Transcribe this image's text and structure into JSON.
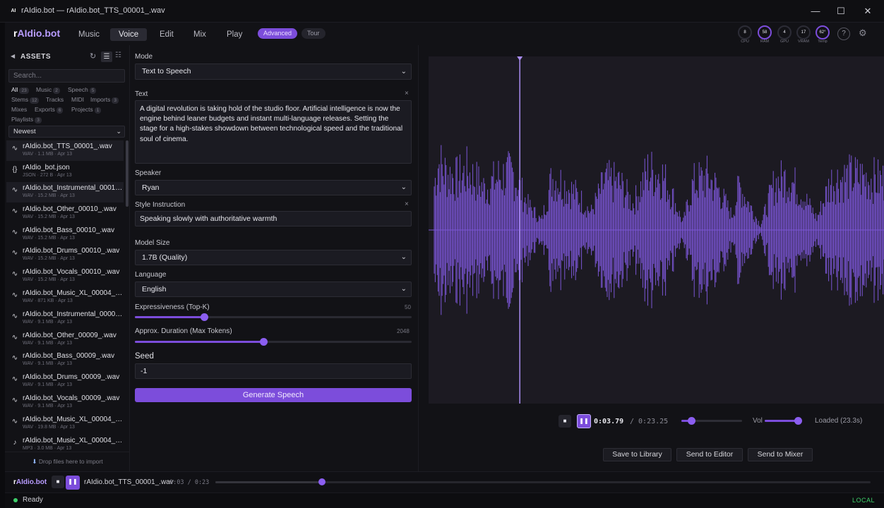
{
  "window": {
    "title": "rAIdio.bot — rAIdio.bot_TTS_00001_.wav",
    "icon_text": "AI",
    "controls": [
      "—",
      "☐",
      "✕"
    ]
  },
  "header": {
    "brand_prefix": "r",
    "brand_rest": "AIdio.bot",
    "tabs": [
      "Music",
      "Voice",
      "Edit",
      "Mix",
      "Play"
    ],
    "active_tab": "Voice",
    "advanced_label": "Advanced",
    "tour_label": "Tour",
    "gauges": [
      {
        "value": "8",
        "label": "CPU"
      },
      {
        "value": "58",
        "label": "RAM"
      },
      {
        "value": "4",
        "label": "GPU"
      },
      {
        "value": "17",
        "label": "VRAM"
      },
      {
        "value": "62°",
        "label": "Temp"
      }
    ],
    "help_glyph": "?",
    "settings_glyph": "⚙"
  },
  "sidebar": {
    "title": "ASSETS",
    "search_placeholder": "Search...",
    "filters": [
      {
        "label": "All",
        "count": "23",
        "active": true
      },
      {
        "label": "Music",
        "count": "2"
      },
      {
        "label": "Speech",
        "count": "5"
      },
      {
        "label": "Stems",
        "count": "12"
      },
      {
        "label": "Tracks",
        "count": ""
      },
      {
        "label": "MIDI",
        "count": ""
      },
      {
        "label": "Imports",
        "count": "3"
      },
      {
        "label": "Mixes",
        "count": ""
      },
      {
        "label": "Exports",
        "count": "6"
      },
      {
        "label": "Projects",
        "count": "1"
      },
      {
        "label": "Playlists",
        "count": "3"
      }
    ],
    "sort": "Newest",
    "assets": [
      {
        "icon": "wave",
        "name": "rAIdio.bot_TTS_00001_.wav",
        "meta": "WAV · 1.1 MB · Apr 13"
      },
      {
        "icon": "json",
        "name": "rAIdio_bot.json",
        "meta": "JSON · 272 B · Apr 13"
      },
      {
        "icon": "wave",
        "name": "rAIdio.bot_Instrumental_00010...",
        "meta": "WAV · 15.2 MB · Apr 13"
      },
      {
        "icon": "wave",
        "name": "rAIdio.bot_Other_00010_.wav",
        "meta": "WAV · 15.2 MB · Apr 13"
      },
      {
        "icon": "wave",
        "name": "rAIdio.bot_Bass_00010_.wav",
        "meta": "WAV · 15.2 MB · Apr 13"
      },
      {
        "icon": "wave",
        "name": "rAIdio.bot_Drums_00010_.wav",
        "meta": "WAV · 15.2 MB · Apr 13"
      },
      {
        "icon": "wave",
        "name": "rAIdio.bot_Vocals_00010_.wav",
        "meta": "WAV · 15.2 MB · Apr 13"
      },
      {
        "icon": "wave",
        "name": "rAIdio.bot_Music_XL_00004_e...",
        "meta": "WAV · 871 KB · Apr 13"
      },
      {
        "icon": "wave",
        "name": "rAIdio.bot_Instrumental_00009...",
        "meta": "WAV · 9.1 MB · Apr 13"
      },
      {
        "icon": "wave",
        "name": "rAIdio.bot_Other_00009_.wav",
        "meta": "WAV · 9.1 MB · Apr 13"
      },
      {
        "icon": "wave",
        "name": "rAIdio.bot_Bass_00009_.wav",
        "meta": "WAV · 9.1 MB · Apr 13"
      },
      {
        "icon": "wave",
        "name": "rAIdio.bot_Drums_00009_.wav",
        "meta": "WAV · 9.1 MB · Apr 13"
      },
      {
        "icon": "wave",
        "name": "rAIdio.bot_Vocals_00009_.wav",
        "meta": "WAV · 9.1 MB · Apr 13"
      },
      {
        "icon": "wave",
        "name": "rAIdio.bot_Music_XL_00004__e...",
        "meta": "WAV · 19.8 MB · Apr 13"
      },
      {
        "icon": "note",
        "name": "rAIdio.bot_Music_XL_00004_.m...",
        "meta": "MP3 · 3.0 MB · Apr 13"
      }
    ],
    "drop_text": "Drop files here to import"
  },
  "form": {
    "mode_label": "Mode",
    "mode_value": "Text to Speech",
    "text_label": "Text",
    "text_value": "A digital revolution is taking hold of the studio floor. Artificial intelligence is now the engine behind leaner budgets and instant multi-language releases. Setting the stage for a high-stakes showdown between technological speed and the traditional soul of cinema.",
    "speaker_label": "Speaker",
    "speaker_value": "Ryan",
    "style_label": "Style Instruction",
    "style_value": "Speaking slowly with authoritative warmth",
    "model_label": "Model Size",
    "model_value": "1.7B (Quality)",
    "language_label": "Language",
    "language_value": "English",
    "expressiveness_label": "Expressiveness (Top-K)",
    "expressiveness_value": "50",
    "expressiveness_fraction": 0.25,
    "duration_label": "Approx. Duration (Max Tokens)",
    "duration_value": "2048",
    "duration_fraction": 0.465,
    "seed_label": "Seed",
    "seed_value": "-1",
    "generate_label": "Generate Speech"
  },
  "player": {
    "current": "0:03.79",
    "total": "/ 0:23.25",
    "progress": 0.163,
    "vol_label": "Vol",
    "volume": 0.9,
    "status": "Loaded (23.3s)",
    "playhead_fraction": 0.2,
    "buttons": [
      "Save to Library",
      "Send to Editor",
      "Send to Mixer"
    ]
  },
  "bottom": {
    "brand_prefix": "r",
    "brand_rest": "AIdio.bot",
    "track": "rAIdio.bot_TTS_00001_.wav",
    "time": "0:03 / 0:23",
    "progress": 0.163,
    "status": "Ready",
    "mode": "LOCAL"
  },
  "colors": {
    "accent": "#7c4ddb",
    "waveform": "#7a55d4",
    "status_green": "#3ecf6a"
  }
}
